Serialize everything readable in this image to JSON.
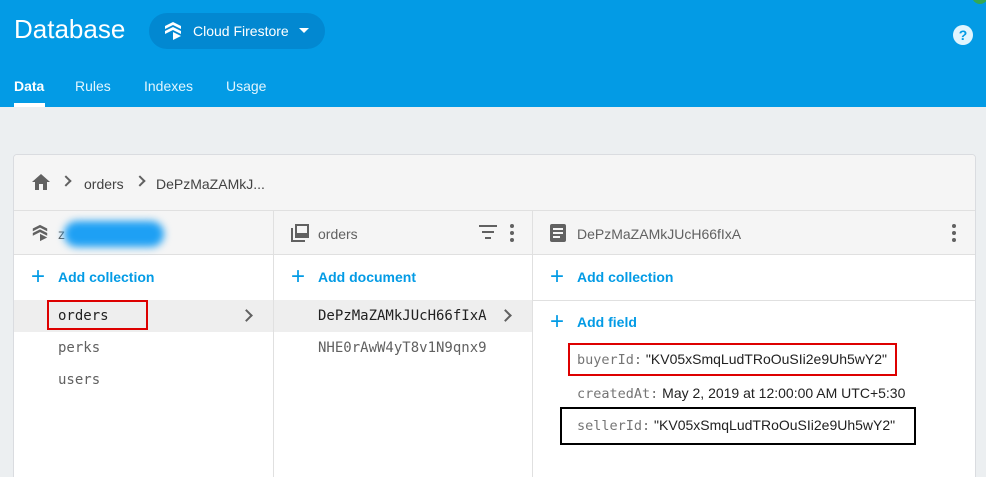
{
  "header": {
    "title": "Database",
    "db_selector": "Cloud Firestore",
    "help_label": "?"
  },
  "tabs": [
    "Data",
    "Rules",
    "Indexes",
    "Usage"
  ],
  "breadcrumb": [
    "orders",
    "DePzMaZAMkJ..."
  ],
  "root_column": {
    "title_prefix": "z",
    "add_label": "Add collection",
    "items": [
      "orders",
      "perks",
      "users"
    ]
  },
  "collection_column": {
    "title": "orders",
    "add_label": "Add document",
    "items": [
      "DePzMaZAMkJUcH66fIxA",
      "NHE0rAwW4yT8v1N9qnx9"
    ]
  },
  "document_column": {
    "title": "DePzMaZAMkJUcH66fIxA",
    "add_collection_label": "Add collection",
    "add_field_label": "Add field",
    "fields": [
      {
        "key": "buyerId:",
        "value": "\"KV05xSmqLudTRoOuSIi2e9Uh5wY2\""
      },
      {
        "key": "createdAt:",
        "value": "May 2, 2019 at 12:00:00 AM UTC+5:30"
      },
      {
        "key": "sellerId:",
        "value": "\"KV05xSmqLudTRoOuSIi2e9Uh5wY2\""
      }
    ]
  },
  "colors": {
    "primary": "#039be5",
    "highlight_red": "#dd0000",
    "highlight_black": "#000000"
  }
}
